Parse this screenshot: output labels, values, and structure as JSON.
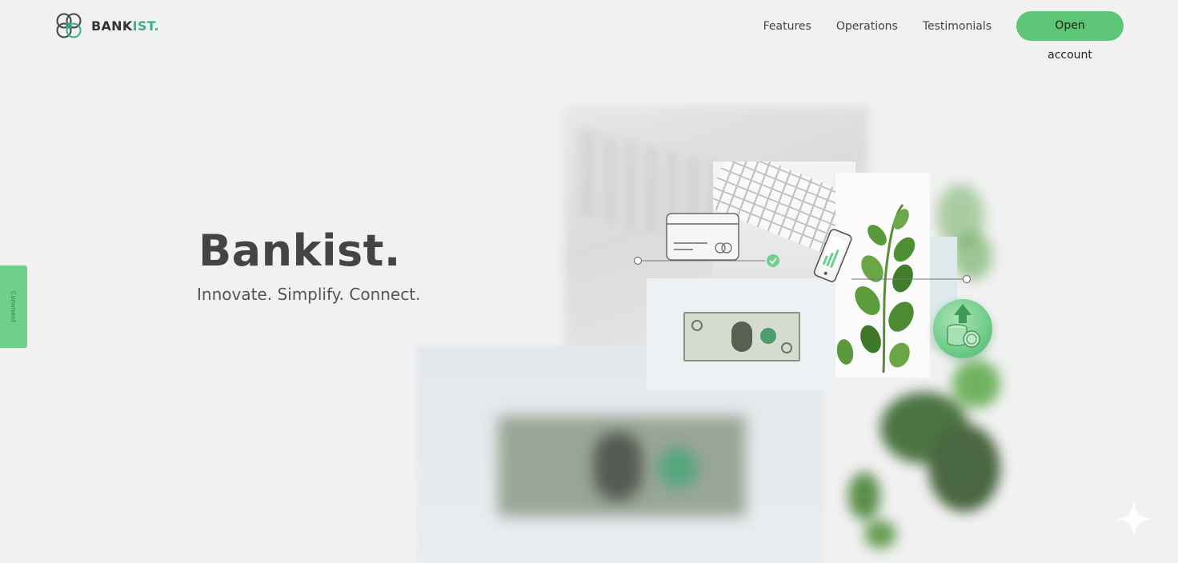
{
  "brand": {
    "name_main": "BANK",
    "name_accent": "IST.",
    "accent_color": "#39b385"
  },
  "nav": {
    "links": [
      "Features",
      "Operations",
      "Testimonials"
    ],
    "cta_label": "Open account",
    "cta_color": "#5ec576"
  },
  "side_tab": {
    "label": "Comment"
  },
  "hero": {
    "title": "Bankist.",
    "subtitle": "Innovate. Simplify. Connect."
  },
  "illustration": {
    "icons": [
      "credit-card-icon",
      "check-icon",
      "phone-chart-icon",
      "coins-upload-icon",
      "dollar-bill-image",
      "plant-image",
      "keyboard-image"
    ],
    "badge_color": "#5ec576"
  }
}
